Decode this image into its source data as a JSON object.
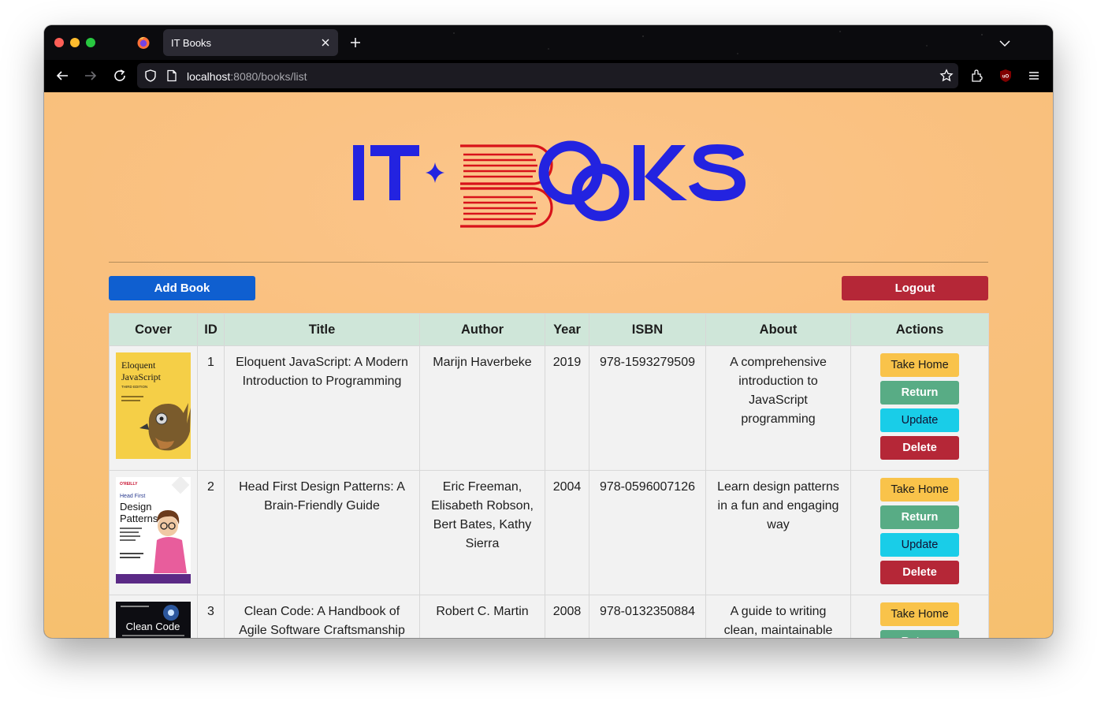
{
  "browser": {
    "tab_title": "IT Books",
    "url_host": "localhost",
    "url_path": ":8080/books/list"
  },
  "page": {
    "logo_text": "IT BOOKS",
    "add_book_label": "Add Book",
    "logout_label": "Logout"
  },
  "table": {
    "headers": [
      "Cover",
      "ID",
      "Title",
      "Author",
      "Year",
      "ISBN",
      "About",
      "Actions"
    ],
    "actions": {
      "take_home": "Take Home",
      "return": "Return",
      "update": "Update",
      "delete": "Delete"
    },
    "rows": [
      {
        "id": "1",
        "title": "Eloquent JavaScript: A Modern Introduction to Programming",
        "author": "Marijn Haverbeke",
        "year": "2019",
        "isbn": "978-1593279509",
        "about": "A comprehensive introduction to JavaScript programming",
        "cover": {
          "line1": "Eloquent",
          "line2": "JavaScript",
          "edition": "THIRD EDITION"
        }
      },
      {
        "id": "2",
        "title": "Head First Design Patterns: A Brain-Friendly Guide",
        "author": "Eric Freeman, Elisabeth Robson, Bert Bates, Kathy Sierra",
        "year": "2004",
        "isbn": "978-0596007126",
        "about": "Learn design patterns in a fun and engaging way",
        "cover": {
          "publisher": "O'REILLY",
          "series": "Head First",
          "line1": "Design",
          "line2": "Patterns"
        }
      },
      {
        "id": "3",
        "title": "Clean Code: A Handbook of Agile Software Craftsmanship",
        "author": "Robert C. Martin",
        "year": "2008",
        "isbn": "978-0132350884",
        "about": "A guide to writing clean, maintainable",
        "cover": {
          "line1": "Clean Code"
        }
      }
    ]
  },
  "colors": {
    "header_bg": "#cfe6d9",
    "add_button": "#0f5fd0",
    "logout_button": "#b52737",
    "take_home": "#f9c34a",
    "return": "#58ac85",
    "update": "#19cde8",
    "delete": "#b52737",
    "logo_blue": "#2323e0",
    "logo_red": "#d8121a"
  }
}
